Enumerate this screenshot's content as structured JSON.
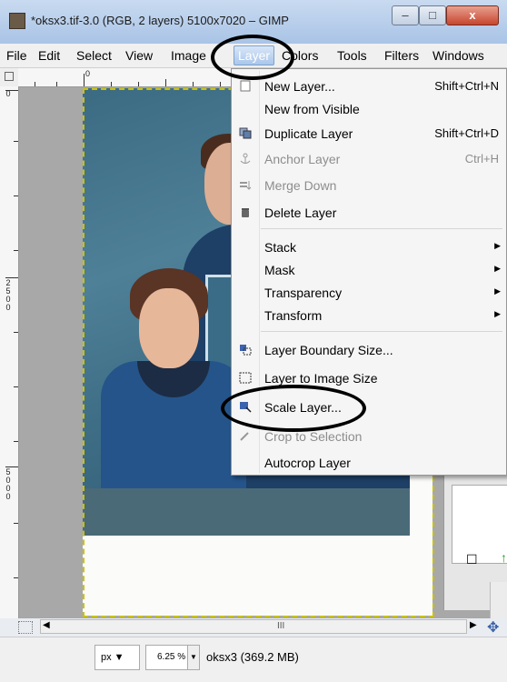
{
  "window": {
    "title": "*oksx3.tif-3.0 (RGB, 2 layers) 5100x7020 – GIMP",
    "minimize": "–",
    "maximize": "□",
    "close": "x"
  },
  "menubar": [
    {
      "label": "File",
      "name": "menu-file"
    },
    {
      "label": "Edit",
      "name": "menu-edit"
    },
    {
      "label": "Select",
      "name": "menu-select"
    },
    {
      "label": "View",
      "name": "menu-view"
    },
    {
      "label": "Image",
      "name": "menu-image"
    },
    {
      "label": "Layer",
      "name": "menu-layer"
    },
    {
      "label": "Colors",
      "name": "menu-colors"
    },
    {
      "label": "Tools",
      "name": "menu-tools"
    },
    {
      "label": "Filters",
      "name": "menu-filters"
    },
    {
      "label": "Windows",
      "name": "menu-windows"
    }
  ],
  "rulers": {
    "top_label": "0",
    "left_labels": [
      "0",
      "2500",
      "5000"
    ]
  },
  "layer_menu": [
    {
      "label": "New Layer...",
      "shortcut": "Shift+Ctrl+N",
      "icon": "new-layer-icon",
      "enabled": true
    },
    {
      "label": "New from Visible",
      "shortcut": "",
      "icon": "",
      "enabled": true
    },
    {
      "label": "Duplicate Layer",
      "shortcut": "Shift+Ctrl+D",
      "icon": "duplicate-layer-icon",
      "enabled": true
    },
    {
      "label": "Anchor Layer",
      "shortcut": "Ctrl+H",
      "icon": "anchor-icon",
      "enabled": false
    },
    {
      "label": "Merge Down",
      "shortcut": "",
      "icon": "merge-down-icon",
      "enabled": false
    },
    {
      "label": "Delete Layer",
      "shortcut": "",
      "icon": "trash-icon",
      "enabled": true
    },
    {
      "label": "Stack",
      "submenu": true,
      "enabled": true
    },
    {
      "label": "Mask",
      "submenu": true,
      "enabled": true
    },
    {
      "label": "Transparency",
      "submenu": true,
      "enabled": true
    },
    {
      "label": "Transform",
      "submenu": true,
      "enabled": true
    },
    {
      "label": "Layer Boundary Size...",
      "shortcut": "",
      "icon": "layer-boundary-icon",
      "enabled": true
    },
    {
      "label": "Layer to Image Size",
      "shortcut": "",
      "icon": "layer-to-image-icon",
      "enabled": true
    },
    {
      "label": "Scale Layer...",
      "shortcut": "",
      "icon": "scale-layer-icon",
      "enabled": true
    },
    {
      "label": "Crop to Selection",
      "shortcut": "",
      "icon": "crop-icon",
      "enabled": false
    },
    {
      "label": "Autocrop Layer",
      "shortcut": "",
      "icon": "",
      "enabled": true
    }
  ],
  "statusbar": {
    "unit": "px",
    "zoom": "6.25 %",
    "info": "oksx3 (369.2 MB)"
  },
  "scroll_mark": "III",
  "colors": {
    "menu_bg": "#f5f5f5",
    "highlight": "#a9c6ec",
    "annotation": "#000000",
    "selection_border": "#c8c200"
  }
}
